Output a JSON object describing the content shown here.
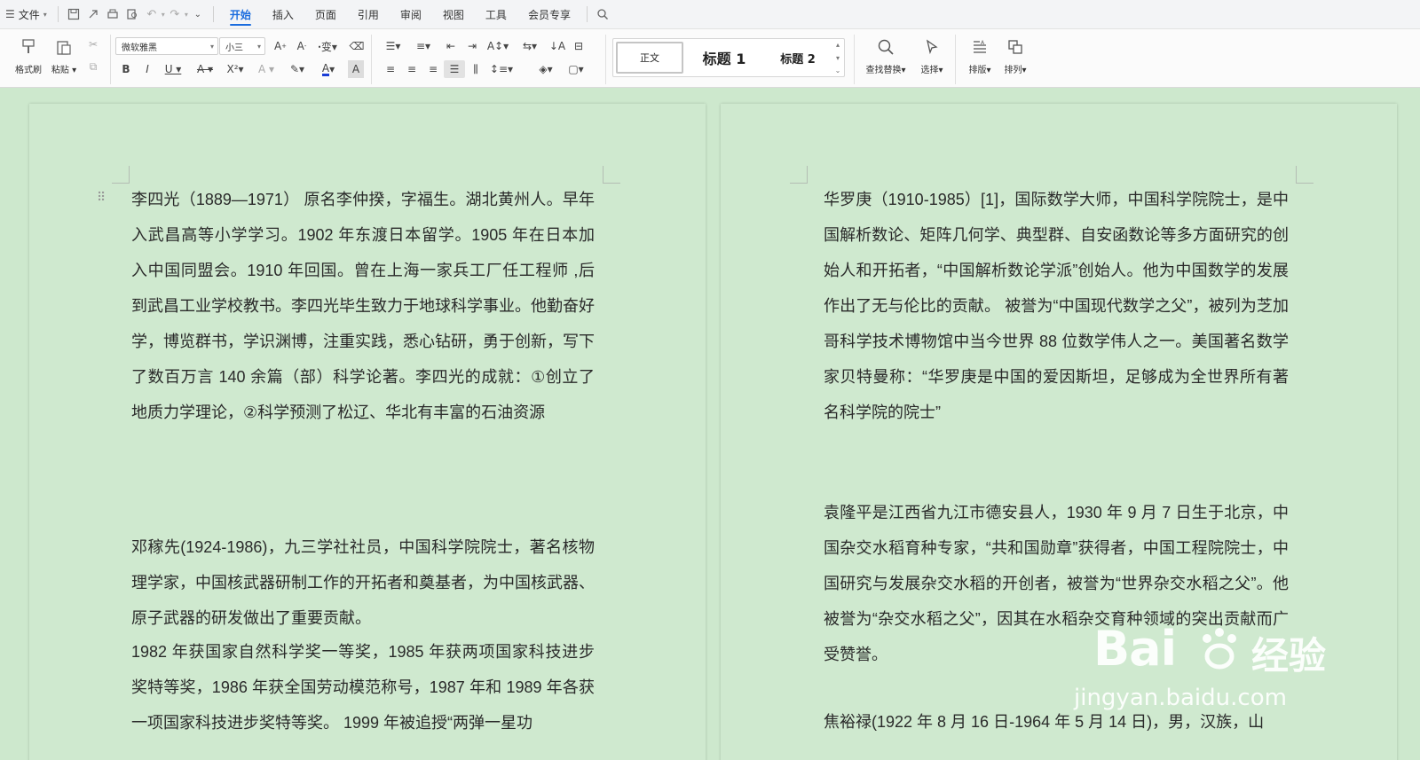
{
  "menubar": {
    "file": "文件",
    "tabs": [
      {
        "label": "开始",
        "active": true
      },
      {
        "label": "插入"
      },
      {
        "label": "页面"
      },
      {
        "label": "引用"
      },
      {
        "label": "审阅"
      },
      {
        "label": "视图"
      },
      {
        "label": "工具"
      },
      {
        "label": "会员专享"
      }
    ]
  },
  "ribbon": {
    "format_painter": "格式刷",
    "paste": "粘贴",
    "font_name": "微软雅黑",
    "font_size": "小三",
    "styles": {
      "normal": "正文",
      "heading1": "标题 1",
      "heading2": "标题 2"
    },
    "find_replace": "查找替换",
    "select": "选择",
    "layout": "排版",
    "arrange": "排列"
  },
  "document": {
    "left_page": {
      "paragraphs": [
        "李四光（1889—1971） 原名李仲揆，字福生。湖北黄州人。早年入武昌高等小学学习。1902 年东渡日本留学。1905 年在日本加入中国同盟会。1910 年回国。曾在上海一家兵工厂任工程师 ,后到武昌工业学校教书。李四光毕生致力于地球科学事业。他勤奋好学，博览群书，学识渊博，注重实践，悉心钻研，勇于创新，写下了数百万言 140 余篇（部）科学论著。李四光的成就：①创立了地质力学理论，②科学预测了松辽、华北有丰富的石油资源",
        "邓稼先(1924-1986)，九三学社社员，中国科学院院士，著名核物理学家，中国核武器研制工作的开拓者和奠基者，为中国核武器、原子武器的研发做出了重要贡献。",
        "1982 年获国家自然科学奖一等奖，1985 年获两项国家科技进步奖特等奖，1986 年获全国劳动模范称号，1987 年和 1989 年各获一项国家科技进步奖特等奖。 1999 年被追授“两弹一星功"
      ]
    },
    "right_page": {
      "paragraphs": [
        "华罗庚（1910-1985）[1]，国际数学大师，中国科学院院士，是中国解析数论、矩阵几何学、典型群、自安函数论等多方面研究的创始人和开拓者，“中国解析数论学派”创始人。他为中国数学的发展作出了无与伦比的贡献。 被誉为“中国现代数学之父”，被列为芝加哥科学技术博物馆中当今世界 88 位数学伟人之一。美国著名数学家贝特曼称：“华罗庚是中国的爱因斯坦，足够成为全世界所有著名科学院的院士”",
        "袁隆平是江西省九江市德安县人，1930 年 9 月 7 日生于北京，中国杂交水稻育种专家，“共和国勋章”获得者，中国工程院院士，中国研究与发展杂交水稻的开创者，被誉为“世界杂交水稻之父”。他被誉为“杂交水稻之父”，因其在水稻杂交育种领域的突出贡献而广受赞誉。",
        "焦裕禄(1922 年 8 月 16 日-1964 年 5 月 14 日)，男，汉族，山"
      ]
    }
  },
  "watermark": {
    "brand": "Bai",
    "brand2": "经验",
    "url": "jingyan.baidu.com"
  }
}
